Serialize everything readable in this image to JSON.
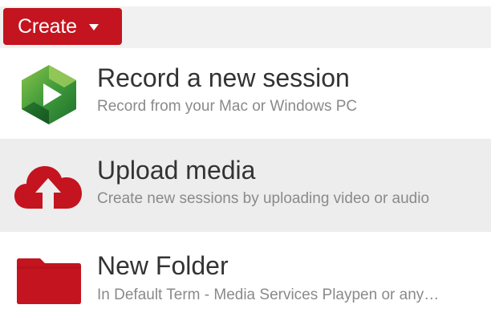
{
  "toolbar": {
    "create_label": "Create",
    "dropdown_icon": "caret-down-icon",
    "colors": {
      "create_button": "#c4141f",
      "toolbar_bg": "#f1f1f1"
    }
  },
  "menu": {
    "items": [
      {
        "title": "Record a new session",
        "description": "Record from your Mac or Windows PC",
        "icon": "panopto-play-icon",
        "highlighted": false
      },
      {
        "title": "Upload media",
        "description": "Create new sessions by uploading video or audio",
        "icon": "cloud-upload-icon",
        "highlighted": true
      },
      {
        "title": "New Folder",
        "description": "In Default Term - Media Services Playpen or any…",
        "icon": "folder-icon",
        "highlighted": false
      }
    ],
    "colors": {
      "hover_bg": "#ededed",
      "title_text": "#333333",
      "description_text": "#8a8a8a",
      "icon_red": "#c4141f",
      "icon_green": "#4e9a28"
    }
  }
}
